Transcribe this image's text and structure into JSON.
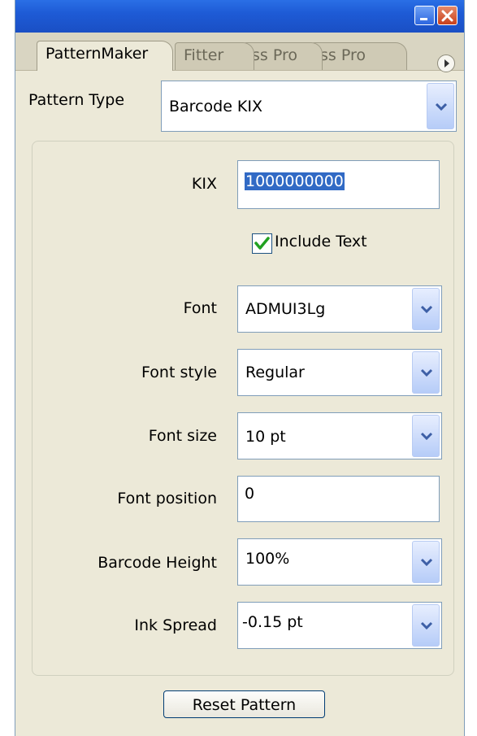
{
  "tabs": [
    {
      "label": "PatternMaker",
      "active": true
    },
    {
      "label": "Fitter",
      "active": false
    },
    {
      "label": "ss Pro",
      "active": false
    },
    {
      "label": "ss Pro",
      "active": false
    }
  ],
  "pattern_type": {
    "label": "Pattern Type",
    "value": "Barcode KIX"
  },
  "kix": {
    "label": "KIX",
    "value": "1000000000"
  },
  "include_text": {
    "label": "Include Text",
    "checked": true
  },
  "font": {
    "label": "Font",
    "value": "ADMUI3Lg"
  },
  "font_style": {
    "label": "Font style",
    "value": "Regular"
  },
  "font_size": {
    "label": "Font size",
    "value": "10 pt"
  },
  "font_position": {
    "label": "Font position",
    "value": "0"
  },
  "barcode_height": {
    "label": "Barcode Height",
    "value": "100%"
  },
  "ink_spread": {
    "label": "Ink Spread",
    "value": "-0.15 pt"
  },
  "reset_button": {
    "label": "Reset Pattern"
  },
  "icons": {
    "minimize": "minimize-icon",
    "close": "close-icon",
    "flyout": "flyout-menu-icon",
    "dropdown": "chevron-down-icon",
    "check": "checkmark-icon"
  },
  "colors": {
    "titlebar": "#1e5bd6",
    "panel": "#ece9d8",
    "selection": "#316ac5",
    "check": "#21a121"
  }
}
